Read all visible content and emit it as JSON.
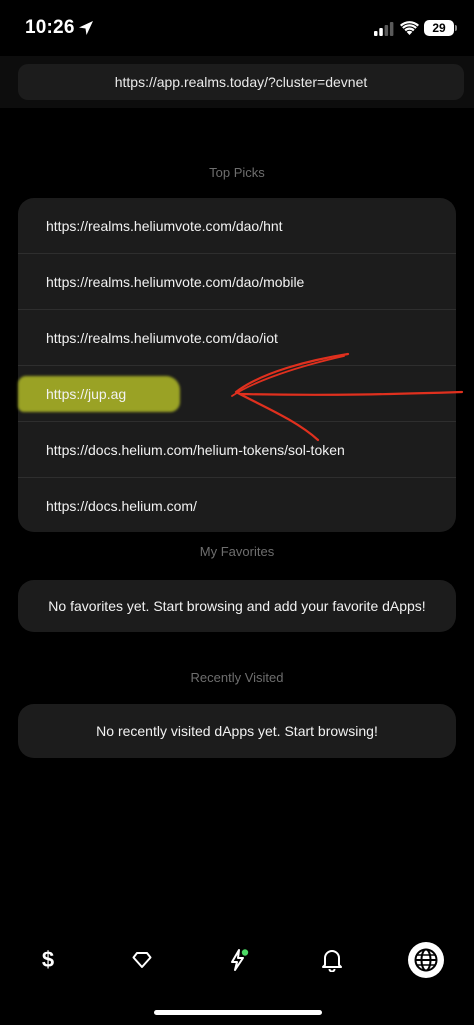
{
  "status_bar": {
    "time": "10:26",
    "battery": "29"
  },
  "browser": {
    "url": "https://app.realms.today/?cluster=devnet"
  },
  "top_picks": {
    "title": "Top Picks",
    "items": [
      "https://realms.heliumvote.com/dao/hnt",
      "https://realms.heliumvote.com/dao/mobile",
      "https://realms.heliumvote.com/dao/iot",
      "https://jup.ag",
      "https://docs.helium.com/helium-tokens/sol-token",
      "https://docs.helium.com/"
    ]
  },
  "favorites": {
    "title": "My Favorites",
    "empty_message": "No favorites yet. Start browsing and add your favorite dApps!"
  },
  "recently_visited": {
    "title": "Recently Visited",
    "empty_message": "No recently visited dApps yet. Start browsing!"
  },
  "tabs": {
    "wallet_symbol": "$",
    "icons": [
      "dollar-icon",
      "diamond-icon",
      "lightning-icon",
      "bell-icon",
      "globe-icon"
    ],
    "notification_dot_color": "#4cd964"
  },
  "colors": {
    "annotation_red": "#e0301e",
    "highlight_yellow": "#bec828"
  }
}
